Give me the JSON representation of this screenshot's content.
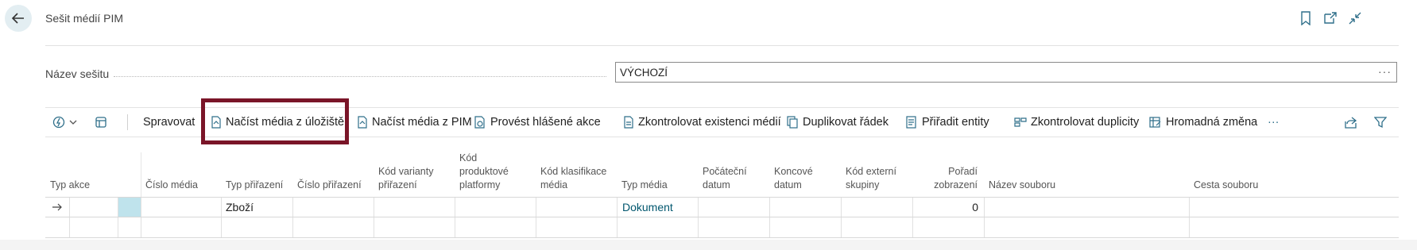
{
  "header": {
    "title": "Sešit médií PIM",
    "back_label": "←"
  },
  "field": {
    "label": "Název sešitu",
    "value": "VÝCHOZÍ",
    "more": "···"
  },
  "toolbar": {
    "manage": "Spravovat",
    "load_from_storage": "Načíst média z úložiště",
    "load_from_pim": "Načíst média z PIM",
    "process_actions": "Provést hlášené akce",
    "check_existence": "Zkontrolovat existenci médií",
    "duplicate_row": "Duplikovat řádek",
    "assign_entities": "Přiřadit entity",
    "check_duplicates": "Zkontrolovat duplicity",
    "mass_change": "Hromadná změna",
    "more": "···"
  },
  "columns": {
    "action_type": "Typ akce",
    "media_no": "Číslo média",
    "assign_type": "Typ přiřazení",
    "assign_no": "Číslo přiřazení",
    "variant_code": [
      "Kód varianty",
      "přiřazení"
    ],
    "platform_code": [
      "Kód",
      "produktové",
      "platformy"
    ],
    "class_code": [
      "Kód klasifikace",
      "média"
    ],
    "media_type": "Typ média",
    "start_date": [
      "Počáteční",
      "datum"
    ],
    "end_date": [
      "Koncové",
      "datum"
    ],
    "ext_group": [
      "Kód externí",
      "skupiny"
    ],
    "display_order": [
      "Pořadí",
      "zobrazení"
    ],
    "file_name": "Název souboru",
    "file_path": "Cesta souboru"
  },
  "rows": [
    {
      "assign_type": "Zboží",
      "media_type": "Dokument",
      "display_order": "0"
    }
  ],
  "colors": {
    "accent": "#00566e",
    "highlight": "#7a1528"
  }
}
